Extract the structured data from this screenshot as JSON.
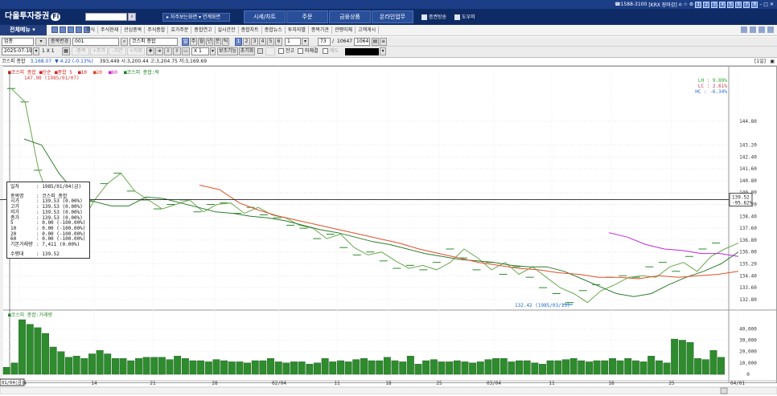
{
  "top_bar": {
    "phone": "☎1588-3100",
    "tail_text": "[KRX 장마감]",
    "num_buttons": [
      "1",
      "2",
      "3",
      "4",
      "5",
      "6",
      "7",
      "8"
    ]
  },
  "menu": {
    "logo": "다올투자증권",
    "logo_badge": "Fi",
    "screen_select": "▸ 자주보는화면 ▾ 연계화면",
    "tabs": [
      "시세/차트",
      "주문",
      "금융상품",
      "온라인업무"
    ],
    "links": [
      "증권방송",
      "도우미"
    ]
  },
  "toolbar": {
    "all_menu": "전체메뉴",
    "links": [
      "주식",
      "주식현재",
      "관심종목",
      "주식종합",
      "호가주문",
      "종합연고",
      "실시간잔",
      "종합차트",
      "종합뉴스",
      "투자자별",
      "종목기관",
      "관평미체",
      "고객게시"
    ]
  },
  "row3": {
    "market": "업종",
    "change_label": "종목변경",
    "code": "001",
    "name": "코스피 종합",
    "periods": [
      "일",
      "주",
      "월",
      "년",
      "분",
      "틱"
    ],
    "intervals": [
      "1",
      "2",
      "3",
      "4",
      "5",
      "6"
    ],
    "interval_select": "1",
    "count_a": "73",
    "count_sep": "/",
    "count_b": "10647",
    "count_c": "1064"
  },
  "row4": {
    "date": "2025-07-19",
    "scale": "1 X 1",
    "nav_buttons": [
      "-종목",
      "+주가",
      "-기간",
      "+자료"
    ],
    "multiplier": "X 1",
    "report": "보조기능",
    "reset": "초기화",
    "check_labels": [
      "잔고",
      "미체결",
      "매도"
    ]
  },
  "info": {
    "name": "코스피 종합",
    "price": "3,168.07",
    "change": "▼ 4.22 (-0.13%)",
    "rest": "393,449 시:3,200.44 고:3,204.75 저:3,169.69",
    "period_tag": "[1일]"
  },
  "price_panel": {
    "legend_items": [
      {
        "text": "코스피 종합",
        "color": "#d22020"
      },
      {
        "text": "단순",
        "color": "#d22020"
      },
      {
        "text": "종합 5",
        "color": "#d22020"
      },
      {
        "text": "10",
        "color": "#d22020"
      },
      {
        "text": "20",
        "color": "#e04020"
      },
      {
        "text": "60",
        "color": "#d020d0"
      },
      {
        "text": "코스피 종합:락",
        "color": "#208020"
      }
    ],
    "legend_sub": "147.90 (1985/01/07)",
    "hi_label": "147.90",
    "low_label": "132.42 (1985/03/13)",
    "y_ticks": [
      "144.80",
      "143.20",
      "142.40",
      "141.60",
      "140.80",
      "140.00",
      "139.20",
      "138.40",
      "137.60",
      "136.80",
      "136.00",
      "135.20",
      "134.40",
      "133.60",
      "132.80"
    ],
    "cursor_price": "139.52",
    "cursor_delta": "-95.62%",
    "lh_label": "LH : 9.89%",
    "lc_label": "LC : 2.61%",
    "hc_label": "HC : -6.34%"
  },
  "tooltip": {
    "date_label": "일자",
    "date": ": 1985/01/04(금)",
    "name_label": "종목명",
    "name": ": 코스피 종합",
    "rows": [
      {
        "k": "시가",
        "v": ": 139.53 (0.00%)"
      },
      {
        "k": "고가",
        "v": ": 139.53 (0.00%)"
      },
      {
        "k": "저가",
        "v": ": 139.53 (0.00%)"
      },
      {
        "k": "종가",
        "v": ": 139.53 (0.00%)"
      },
      {
        "k": "5",
        "v": ": 0.00 (-100.00%)"
      },
      {
        "k": "10",
        "v": ": 0.00 (-100.00%)"
      },
      {
        "k": "20",
        "v": ": 0.00 (-100.00%)"
      },
      {
        "k": "60",
        "v": ": 0.00 (-100.00%)"
      },
      {
        "k": "기본거래량",
        "v": ": 7,411 (0.00%)"
      }
    ],
    "cursor_label": "수평대",
    "cursor_value": ": 139.52"
  },
  "volume_panel": {
    "legend": "코스피 종합:거래량",
    "y_ticks": [
      "40,000",
      "30,000",
      "20,000",
      "10,000",
      "0"
    ],
    "bars": [
      6200,
      10000,
      48000,
      44000,
      41000,
      36000,
      24000,
      20000,
      15000,
      16000,
      14000,
      18000,
      21000,
      18000,
      14000,
      14000,
      12000,
      14000,
      15000,
      15000,
      15000,
      13000,
      16000,
      14000,
      12000,
      12000,
      11000,
      13000,
      12000,
      11000,
      11000,
      10000,
      12000,
      12000,
      14000,
      11000,
      10000,
      11000,
      11000,
      9000,
      10000,
      14000,
      11000,
      12000,
      11000,
      13000,
      14000,
      12000,
      12000,
      15000,
      12000,
      11000,
      16000,
      9000,
      12000,
      13000,
      11000,
      11000,
      12000,
      11000,
      10000,
      11000,
      13000,
      14000,
      14000,
      11000,
      12000,
      12000,
      10000,
      9000,
      12000,
      12000,
      13000,
      14000,
      12000,
      11000,
      12000,
      12000,
      14000,
      12000,
      14000,
      12000,
      11000,
      16000,
      12000,
      10000,
      31000,
      30000,
      28000,
      14000,
      13000,
      21000,
      15000
    ]
  },
  "x_axis": {
    "labels": [
      "01/04",
      "14",
      "21",
      "28",
      "02/04",
      "11",
      "18",
      "25",
      "03/04",
      "11",
      "18",
      "25",
      "04/01"
    ],
    "cursor_date": "01/04(금)"
  },
  "chart_data": {
    "type": "line",
    "title": "코스피 종합",
    "x": [
      "1985/01/04",
      "1985/04/01"
    ],
    "price_range": [
      132.4,
      147.9
    ],
    "series": [
      {
        "name": "코스피 종합",
        "values": [
          147.0,
          146.1,
          141.5,
          139.0,
          138.0,
          137.7,
          139.4,
          140.6,
          141.3,
          140.1,
          139.5,
          138.9,
          139.2,
          139.5,
          138.7,
          139.2,
          139.3,
          138.6,
          139.0,
          138.5,
          138.3,
          137.8,
          137.6,
          136.9,
          137.2,
          136.3,
          135.8,
          136.0,
          135.4,
          134.9,
          135.1,
          134.8,
          135.3,
          136.2,
          135.6,
          134.8,
          135.3,
          134.5,
          135.0,
          134.3,
          133.6,
          133.2,
          132.6,
          133.4,
          133.8,
          134.3,
          134.4,
          134.3,
          135.0,
          135.3,
          134.7,
          135.7,
          136.2,
          136.6
        ]
      },
      {
        "name": "5",
        "values": [
          143.6,
          143.2,
          141.3,
          139.9,
          139.4,
          139.1,
          139.1,
          139.7,
          139.6,
          139.3,
          139.0,
          138.7,
          138.6,
          138.4,
          138.3,
          138.1,
          137.8,
          137.5,
          137.3,
          137.0,
          136.7,
          136.5,
          136.2,
          135.9,
          135.7,
          135.5,
          135.4,
          135.3,
          135.1,
          135.0,
          135.0,
          134.7,
          134.2,
          133.7,
          133.2,
          133.0,
          133.2,
          133.8,
          134.3,
          134.7,
          135.2,
          136.0
        ]
      },
      {
        "name": "20",
        "values": [
          140.5,
          140.2,
          139.3,
          138.8,
          138.4,
          138.1,
          137.8,
          137.5,
          137.2,
          136.9,
          136.6,
          136.2,
          135.9,
          135.6,
          135.3,
          135.1,
          134.9,
          134.8,
          134.6,
          134.5,
          134.3,
          134.3,
          134.2,
          134.4,
          134.3,
          134.4,
          134.5,
          134.7
        ]
      },
      {
        "name": "60",
        "values": [
          137.3,
          137.0,
          136.5,
          136.2,
          136.1,
          135.9,
          135.9,
          135.7
        ]
      }
    ]
  }
}
